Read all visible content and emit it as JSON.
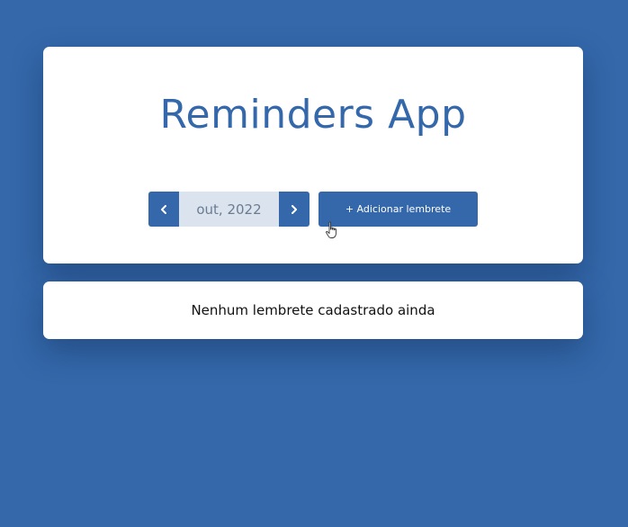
{
  "header": {
    "title": "Reminders App"
  },
  "month_nav": {
    "prev_icon": "chevron-left-icon",
    "next_icon": "chevron-right-icon",
    "current_month": "out, 2022"
  },
  "add_button": {
    "label": "+ Adicionar lembrete"
  },
  "reminders": {
    "empty_message": "Nenhum lembrete cadastrado ainda",
    "items": []
  },
  "colors": {
    "background": "#3468aa",
    "accent": "#3468aa",
    "month_display_bg": "#dae3ee",
    "card": "#ffffff"
  }
}
